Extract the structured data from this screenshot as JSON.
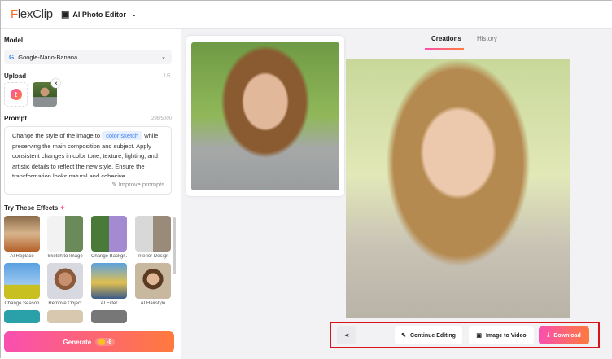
{
  "header": {
    "logo_accent": "F",
    "logo_rest": "lexClip",
    "editor_label": "AI Photo Editor"
  },
  "left": {
    "model_label": "Model",
    "model_value": "Google-Nano-Banana",
    "upload_label": "Upload",
    "upload_count": "1/5",
    "prompt_label": "Prompt",
    "prompt_count": "298/5000",
    "prompt_before": "Change the style of the image to ",
    "prompt_chip": "color sketch",
    "prompt_after": " while preserving the main composition and subject. Apply consistent changes in color tone, texture, lighting, and artistic details to reflect the new style. Ensure the transformation looks natural and cohesive.",
    "improve_label": "Improve prompts",
    "effects_label": "Try These Effects",
    "effects": [
      "AI Replace",
      "Sketch to Image",
      "Change Backgr...",
      "Interior Design",
      "Change Season",
      "Remove Object",
      "AI Filter",
      "AI Hairstyle"
    ],
    "generate_label": "Generate",
    "generate_cost": "-8"
  },
  "main": {
    "tabs": [
      "Creations",
      "History"
    ],
    "actions": {
      "continue": "Continue Editing",
      "video": "Image to Video",
      "download": "Download"
    }
  },
  "colors": {
    "accent_start": "#f94fb0",
    "accent_end": "#ff7a3d",
    "highlight": "#d9131b"
  }
}
